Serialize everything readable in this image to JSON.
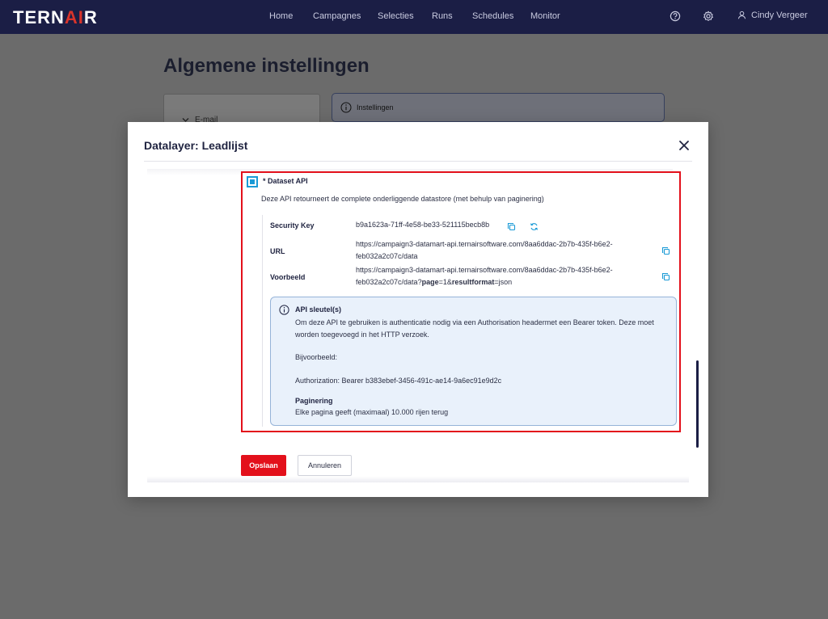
{
  "topbar": {
    "logo_text_1": "TERN",
    "logo_text_2": "AI",
    "logo_text_3": "R",
    "nav_items": [
      {
        "label": "Home"
      },
      {
        "label": "Campagnes"
      },
      {
        "label": "Selecties"
      },
      {
        "label": "Runs"
      },
      {
        "label": "Schedules"
      },
      {
        "label": "Monitor"
      }
    ],
    "icons": [
      "help-icon",
      "settings-icon",
      "user-icon"
    ],
    "user_name": "Cindy Vergeer"
  },
  "page": {
    "title": "Algemene instellingen",
    "left_card_label": "E-mail",
    "info_card_label": "Instellingen"
  },
  "modal": {
    "title": "Datalayer: Leadlijst",
    "section": {
      "checked": true,
      "title": "* Dataset API",
      "description": "Deze API retourneert de complete onderliggende datastore (met behulp van paginering)",
      "rows": [
        {
          "label": "Security Key",
          "value": "b9a1623a-71ff-4e58-be33-521115becb8b"
        },
        {
          "label": "URL",
          "value_line_1": "https://campaign3-datamart-api.ternairsoftware.com/8aa6ddac-2b7b-435f-b6e2-",
          "value_line_2": "feb032a2c07c/data"
        },
        {
          "label": "Voorbeeld",
          "value_line_1": "https://campaign3-datamart-api.ternairsoftware.com/8aa6ddac-2b7b-435f-b6e2-",
          "value_line_2_prefix": "feb032a2c07c/data?",
          "value_line_2_bold_1": "page",
          "value_line_2_mid": "=1&",
          "value_line_2_bold_2": "resultformat",
          "value_line_2_suffix": "=json"
        }
      ],
      "info_box": {
        "title": "API sleutel(s)",
        "text": "Om deze API te gebruiken is authenticatie nodig via een Authorisation headermet een Bearer token. Deze moet worden toegevoegd in het HTTP verzoek.",
        "example_label": "Bijvoorbeeld:",
        "example_value": "Authorization: Bearer b383ebef-3456-491c-ae14-9a6ec91e9d2c",
        "paging_title": "Paginering",
        "paging_text": "Elke pagina geeft (maximaal) 10.000 rijen terug"
      }
    },
    "buttons": {
      "save": "Opslaan",
      "cancel": "Annuleren"
    }
  },
  "colors": {
    "topbar_bg": "#1b1e45",
    "overlay_bg": "#6b6b6b",
    "accent_red": "#e3101b",
    "checkbox_blue": "#1a9ad6",
    "info_box_bg": "#e9f1fb"
  }
}
